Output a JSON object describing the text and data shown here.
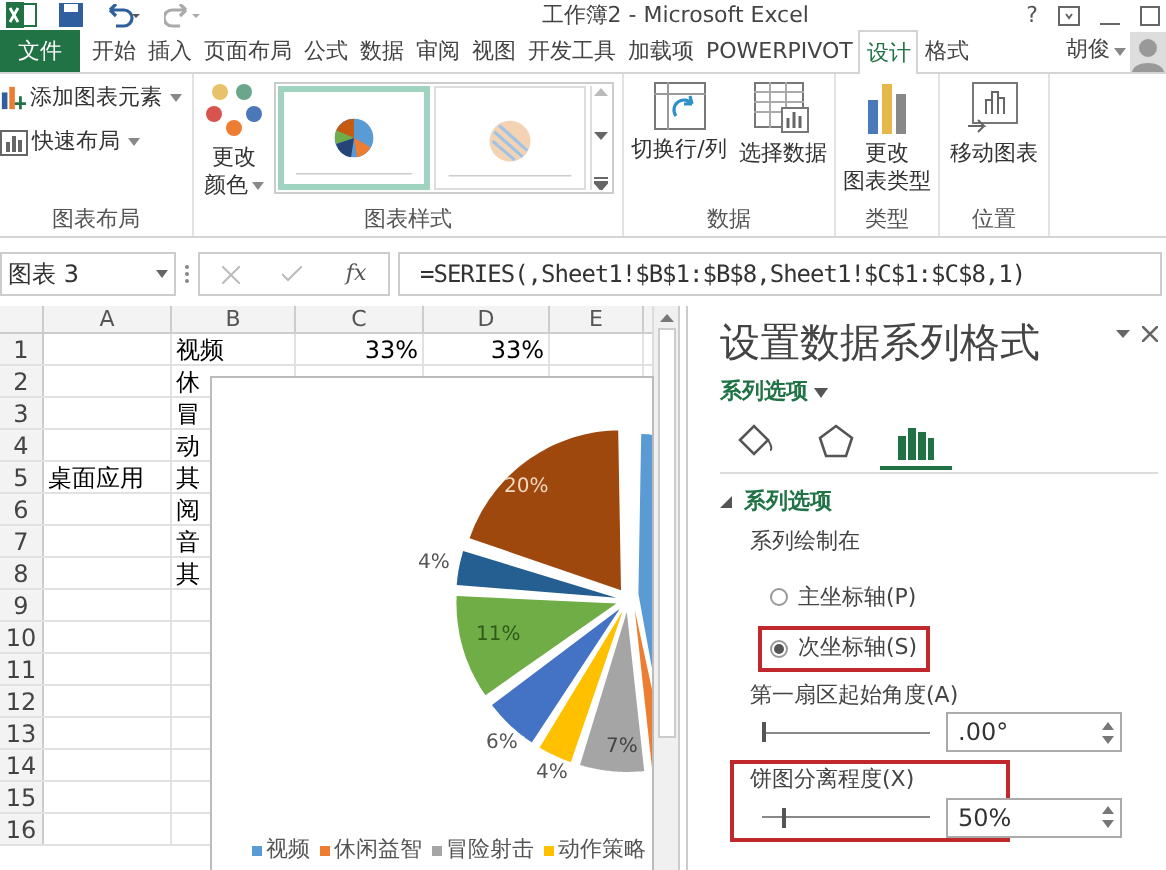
{
  "title_bar": {
    "title": "工作簿2 - Microsoft Excel",
    "help": "?"
  },
  "ribbon_tabs": [
    {
      "label": "文件",
      "kind": "file",
      "selected": false
    },
    {
      "label": "开始",
      "kind": "tab",
      "selected": false
    },
    {
      "label": "插入",
      "kind": "tab",
      "selected": false
    },
    {
      "label": "页面布局",
      "kind": "tab",
      "selected": false
    },
    {
      "label": "公式",
      "kind": "tab",
      "selected": false
    },
    {
      "label": "数据",
      "kind": "tab",
      "selected": false
    },
    {
      "label": "审阅",
      "kind": "tab",
      "selected": false
    },
    {
      "label": "视图",
      "kind": "tab",
      "selected": false
    },
    {
      "label": "开发工具",
      "kind": "tab",
      "selected": false
    },
    {
      "label": "加载项",
      "kind": "tab",
      "selected": false
    },
    {
      "label": "POWERPIVOT",
      "kind": "tab",
      "selected": false
    },
    {
      "label": "设计",
      "kind": "tab",
      "selected": true
    },
    {
      "label": "格式",
      "kind": "tab",
      "selected": false
    }
  ],
  "account": {
    "name": "胡俊"
  },
  "ribbon_groups": [
    {
      "label": "图表布局",
      "commands": [
        {
          "kind": "elements",
          "lines": [
            "添加图表元素"
          ]
        },
        {
          "kind": "layout",
          "lines": [
            "快速布局"
          ]
        }
      ]
    },
    {
      "label": "图表样式",
      "commands": [
        {
          "kind": "colors",
          "lines": [
            "更改",
            "颜色"
          ]
        }
      ],
      "styles": [
        {
          "selected": true
        },
        {
          "selected": false
        }
      ]
    },
    {
      "label": "数据",
      "commands": [
        {
          "kind": "switch",
          "lines": [
            "切换行/列"
          ]
        },
        {
          "kind": "select",
          "lines": [
            "选择数据"
          ]
        }
      ]
    },
    {
      "label": "类型",
      "commands": [
        {
          "kind": "type",
          "lines": [
            "更改",
            "图表类型"
          ]
        }
      ]
    },
    {
      "label": "位置",
      "commands": [
        {
          "kind": "move",
          "lines": [
            "移动图表"
          ]
        }
      ]
    }
  ],
  "formula_bar": {
    "name_box": "图表 3",
    "function_label": "fx",
    "formula": "=SERIES(,Sheet1!$B$1:$B$8,Sheet1!$C$1:$C$8,1)"
  },
  "sheet": {
    "columns": [
      "A",
      "B",
      "C",
      "D",
      "E"
    ],
    "rows": [
      {
        "number": "1",
        "cells": {
          "b": "视频",
          "c": "33%",
          "d": "33%"
        }
      },
      {
        "number": "2",
        "cells": {
          "b": "休"
        }
      },
      {
        "number": "3",
        "cells": {
          "b": "冒"
        }
      },
      {
        "number": "4",
        "cells": {
          "b": "动"
        }
      },
      {
        "number": "5",
        "cells": {
          "a": "桌面应用",
          "b": "其"
        }
      },
      {
        "number": "6",
        "cells": {
          "b": "阅"
        }
      },
      {
        "number": "7",
        "cells": {
          "b": "音"
        }
      },
      {
        "number": "8",
        "cells": {
          "b": "其"
        }
      },
      {
        "number": "9",
        "cells": {}
      },
      {
        "number": "10",
        "cells": {}
      },
      {
        "number": "11",
        "cells": {}
      },
      {
        "number": "12",
        "cells": {}
      },
      {
        "number": "13",
        "cells": {}
      },
      {
        "number": "14",
        "cells": {}
      },
      {
        "number": "15",
        "cells": {}
      },
      {
        "number": "16",
        "cells": {}
      }
    ]
  },
  "chart": {
    "data_labels": [
      {
        "text": "20%"
      },
      {
        "text": "4%"
      },
      {
        "text": "11%"
      },
      {
        "text": "6%"
      },
      {
        "text": "4%"
      },
      {
        "text": "7%"
      }
    ],
    "legend": [
      {
        "label": "视频",
        "color": "#5b9bd5"
      },
      {
        "label": "休闲益智",
        "color": "#ed7d31"
      },
      {
        "label": "冒险射击",
        "color": "#a5a5a5"
      },
      {
        "label": "动作策略",
        "color": "#ffc000"
      }
    ]
  },
  "pane": {
    "title": "设置数据系列格式",
    "options_menu": "系列选项",
    "tabs": [
      {
        "kind": "fill",
        "selected": false
      },
      {
        "kind": "effects",
        "selected": false
      },
      {
        "kind": "series",
        "selected": true
      }
    ],
    "section": {
      "title": "系列选项",
      "expanded": true
    },
    "plot_on_label": "系列绘制在",
    "axis_options": [
      {
        "label": "主坐标轴(P)",
        "selected": false,
        "highlighted": false
      },
      {
        "label": "次坐标轴(S)",
        "selected": true,
        "highlighted": true
      }
    ],
    "sliders": [
      {
        "label": "第一扇区起始角度(A)",
        "level": 0,
        "value": ".00°",
        "highlighted": false
      },
      {
        "label": "饼图分离程度(X)",
        "level": 0.125,
        "value": "50%",
        "highlighted": true
      }
    ]
  }
}
